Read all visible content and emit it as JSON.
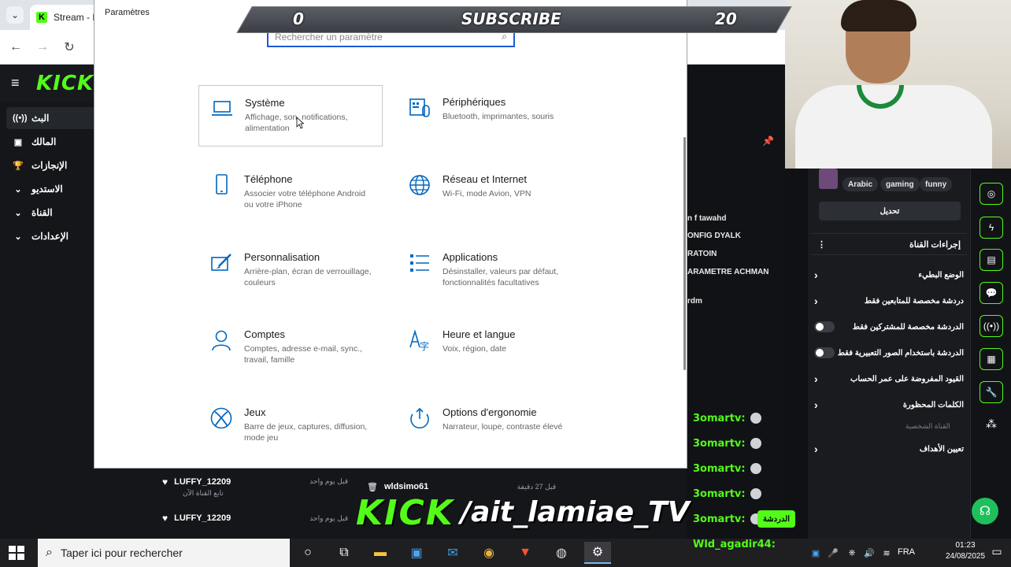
{
  "browser": {
    "tab_title": "Stream - K",
    "tab_menu_icon": "chevron-down-icon"
  },
  "kick": {
    "logo": "KICK",
    "sidebar": [
      {
        "label": "البث",
        "icon": "broadcast-icon",
        "active": true
      },
      {
        "label": "المالك",
        "icon": "owner-icon",
        "active": false
      },
      {
        "label": "الإنجازات",
        "icon": "trophy-icon",
        "active": false
      },
      {
        "label": "الاستديو",
        "icon": "chevron-down-icon",
        "active": false
      },
      {
        "label": "القناة",
        "icon": "chevron-down-icon",
        "active": false
      },
      {
        "label": "الإعدادات",
        "icon": "chevron-down-icon",
        "active": false
      }
    ],
    "tags": [
      "Arabic",
      "gaming",
      "funny"
    ],
    "edit_label": "تحديل",
    "channel_actions_title": "إجراءات القناة",
    "actions": [
      {
        "label": "الوضع البطيء",
        "control": "chevron"
      },
      {
        "label": "دردشة مخصصة للمتابعين فقط",
        "control": "chevron"
      },
      {
        "label": "الدردشة مخصصة للمشتركين فقط",
        "control": "toggle"
      },
      {
        "label": "الدردشة باستخدام الصور التعبيرية فقط",
        "control": "toggle"
      },
      {
        "label": "القيود المفروضة على عمر الحساب",
        "control": "chevron"
      },
      {
        "label": "الكلمات المحظورة",
        "control": "chevron"
      },
      {
        "label": "تعيين الأهداف",
        "control": "chevron"
      }
    ],
    "section_note": "القناة الشخصية",
    "mid_texts": [
      "n f tawahd",
      "ONFIG DYALK",
      "RATOIN",
      "ARAMETRE ACHMAN",
      "rdm"
    ],
    "chat": [
      {
        "user": "3omartv:"
      },
      {
        "user": "3omartv:"
      },
      {
        "user": "3omartv:"
      },
      {
        "user": "3omartv:"
      },
      {
        "user": "3omartv:"
      }
    ],
    "chat_send_label": "الدردشة",
    "events_left": [
      {
        "name": "LUFFY_12209",
        "sub": "تابع القناة الآن",
        "time": "قبل يوم واحد"
      },
      {
        "name": "LUFFY_12209",
        "sub": "",
        "time": "قبل يوم واحد"
      }
    ],
    "events_right": [
      {
        "name": "wldsimo61",
        "time": "قبل 27 دقيقة"
      }
    ]
  },
  "overlay": {
    "left_count": "0",
    "label": "SUBSCRIBE",
    "right_count": "20",
    "watermark_kick": "KICK",
    "watermark_handle": "/ait_lamiae_TV"
  },
  "settings": {
    "title": "Paramètres",
    "search_placeholder": "Rechercher un paramètre",
    "categories": [
      {
        "title": "Système",
        "desc": "Affichage, son, notifications, alimentation",
        "icon": "laptop-icon",
        "selected": true
      },
      {
        "title": "Périphériques",
        "desc": "Bluetooth, imprimantes, souris",
        "icon": "keyboard-icon",
        "selected": false
      },
      {
        "title": "Téléphone",
        "desc": "Associer votre téléphone Android ou votre iPhone",
        "icon": "phone-icon",
        "selected": false
      },
      {
        "title": "Réseau et Internet",
        "desc": "Wi-Fi, mode Avion, VPN",
        "icon": "globe-icon",
        "selected": false
      },
      {
        "title": "Personnalisation",
        "desc": "Arrière-plan, écran de verrouillage, couleurs",
        "icon": "brush-icon",
        "selected": false
      },
      {
        "title": "Applications",
        "desc": "Désinstaller, valeurs par défaut, fonctionnalités facultatives",
        "icon": "apps-list-icon",
        "selected": false
      },
      {
        "title": "Comptes",
        "desc": "Comptes, adresse e-mail, sync., travail, famille",
        "icon": "person-icon",
        "selected": false
      },
      {
        "title": "Heure et langue",
        "desc": "Voix, région, date",
        "icon": "time-language-icon",
        "selected": false
      },
      {
        "title": "Jeux",
        "desc": "Barre de jeux, captures, diffusion, mode jeu",
        "icon": "xbox-icon",
        "selected": false
      },
      {
        "title": "Options d'ergonomie",
        "desc": "Narrateur, loupe, contraste élevé",
        "icon": "ease-of-access-icon",
        "selected": false
      }
    ]
  },
  "taskbar": {
    "search_text": "Taper ici pour rechercher",
    "tray_user": "Wld_agadir44:",
    "lang": "FRA",
    "time": "01:23",
    "date": "24/08/2025"
  },
  "colors": {
    "kick_green": "#53fc18",
    "windows_blue": "#0067c0"
  }
}
